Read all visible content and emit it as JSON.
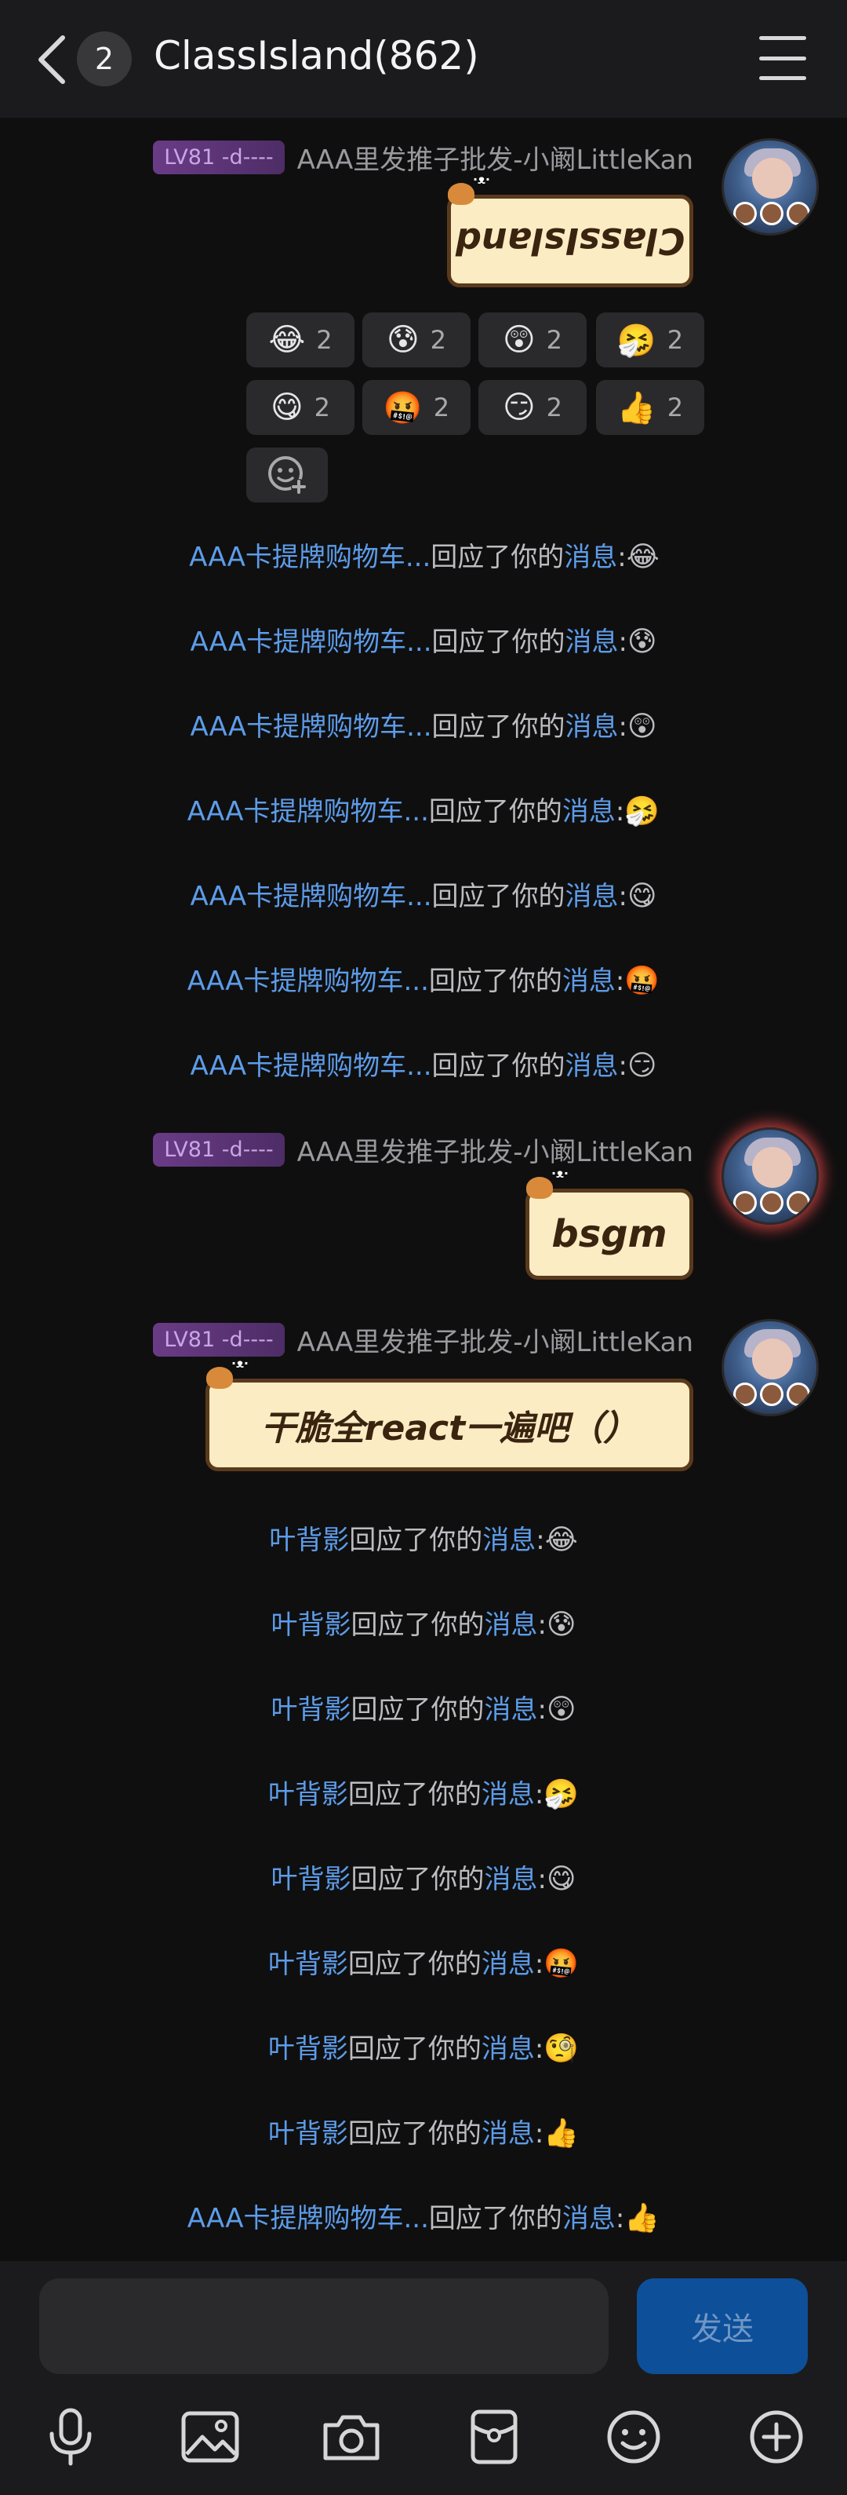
{
  "header": {
    "unread_count": "2",
    "title": "ClassIsland(862)"
  },
  "messages": [
    {
      "level_badge": "LV81 -d----",
      "sender": "AAA里发推子批发-小阚LittleKan",
      "text": "ClassIsland"
    },
    {
      "level_badge": "LV81 -d----",
      "sender": "AAA里发推子批发-小阚LittleKan",
      "text": "bsgm"
    },
    {
      "level_badge": "LV81 -d----",
      "sender": "AAA里发推子批发-小阚LittleKan",
      "text": "干脆全react一遍吧（）"
    }
  ],
  "reactions": [
    {
      "emoji": "😂",
      "count": "2"
    },
    {
      "emoji": "😰",
      "count": "2"
    },
    {
      "emoji": "😲",
      "count": "2"
    },
    {
      "emoji": "🤧",
      "count": "2"
    },
    {
      "emoji": "😋",
      "count": "2"
    },
    {
      "emoji": "🤬",
      "count": "2"
    },
    {
      "emoji": "😏",
      "count": "2"
    },
    {
      "emoji": "👍",
      "count": "2"
    }
  ],
  "notices_group1": [
    {
      "who": "AAA卡提牌购物车...",
      "action": "回应了你的",
      "target": "消息",
      "emoji": "😂"
    },
    {
      "who": "AAA卡提牌购物车...",
      "action": "回应了你的",
      "target": "消息",
      "emoji": "😰"
    },
    {
      "who": "AAA卡提牌购物车...",
      "action": "回应了你的",
      "target": "消息",
      "emoji": "😲"
    },
    {
      "who": "AAA卡提牌购物车...",
      "action": "回应了你的",
      "target": "消息",
      "emoji": "🤧"
    },
    {
      "who": "AAA卡提牌购物车...",
      "action": "回应了你的",
      "target": "消息",
      "emoji": "😋"
    },
    {
      "who": "AAA卡提牌购物车...",
      "action": "回应了你的",
      "target": "消息",
      "emoji": "🤬"
    },
    {
      "who": "AAA卡提牌购物车...",
      "action": "回应了你的",
      "target": "消息",
      "emoji": "😏"
    }
  ],
  "notices_group2": [
    {
      "who": "叶背影",
      "action": "回应了你的",
      "target": "消息",
      "emoji": "😂"
    },
    {
      "who": "叶背影",
      "action": "回应了你的",
      "target": "消息",
      "emoji": "😰"
    },
    {
      "who": "叶背影",
      "action": "回应了你的",
      "target": "消息",
      "emoji": "😲"
    },
    {
      "who": "叶背影",
      "action": "回应了你的",
      "target": "消息",
      "emoji": "🤧"
    },
    {
      "who": "叶背影",
      "action": "回应了你的",
      "target": "消息",
      "emoji": "😋"
    },
    {
      "who": "叶背影",
      "action": "回应了你的",
      "target": "消息",
      "emoji": "🤬"
    },
    {
      "who": "叶背影",
      "action": "回应了你的",
      "target": "消息",
      "emoji": "🧐"
    },
    {
      "who": "叶背影",
      "action": "回应了你的",
      "target": "消息",
      "emoji": "👍"
    },
    {
      "who": "AAA卡提牌购物车...",
      "action": "回应了你的",
      "target": "消息",
      "emoji": "👍"
    }
  ],
  "input": {
    "placeholder": "",
    "send_label": "发送"
  },
  "toolbar": {
    "icons": [
      "microphone-icon",
      "image-icon",
      "camera-icon",
      "red-packet-icon",
      "emoji-icon",
      "plus-icon"
    ]
  },
  "colors": {
    "background": "#0f0f10",
    "bar": "#1b1b1d",
    "link": "#5d9ce8",
    "send": "#0d4f98"
  }
}
